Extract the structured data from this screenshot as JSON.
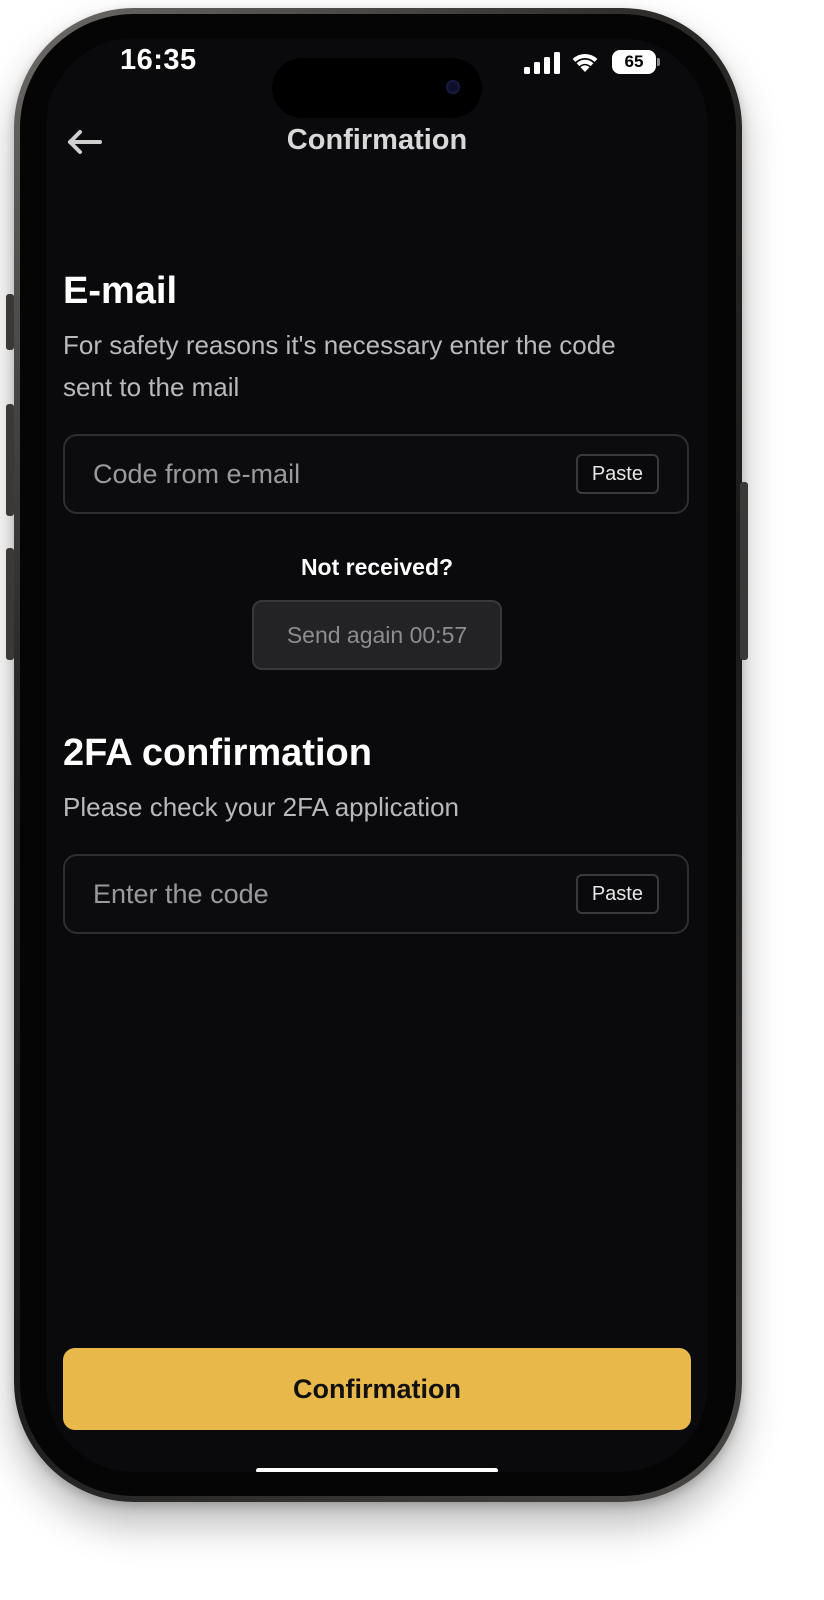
{
  "status_bar": {
    "time": "16:35",
    "battery_level": "65",
    "signal_icon": "cellular-signal-icon",
    "wifi_icon": "wifi-icon"
  },
  "header": {
    "back_icon": "arrow-left-icon",
    "title": "Confirmation"
  },
  "email_section": {
    "title": "E-mail",
    "description": "For safety reasons it's necessary enter the code sent to the mail",
    "input_value": "",
    "input_placeholder": "Code from e-mail",
    "paste_label": "Paste",
    "not_received_label": "Not received?",
    "send_again_label": "Send again 00:57"
  },
  "twofa_section": {
    "title": "2FA confirmation",
    "description": "Please check your 2FA application",
    "input_value": "",
    "input_placeholder": "Enter the code",
    "paste_label": "Paste"
  },
  "footer": {
    "confirm_label": "Confirmation"
  },
  "colors": {
    "background": "#0a0a0c",
    "accent": "#e9b84a",
    "muted_text": "#b9b9bb",
    "field_border": "#2e2e31"
  }
}
